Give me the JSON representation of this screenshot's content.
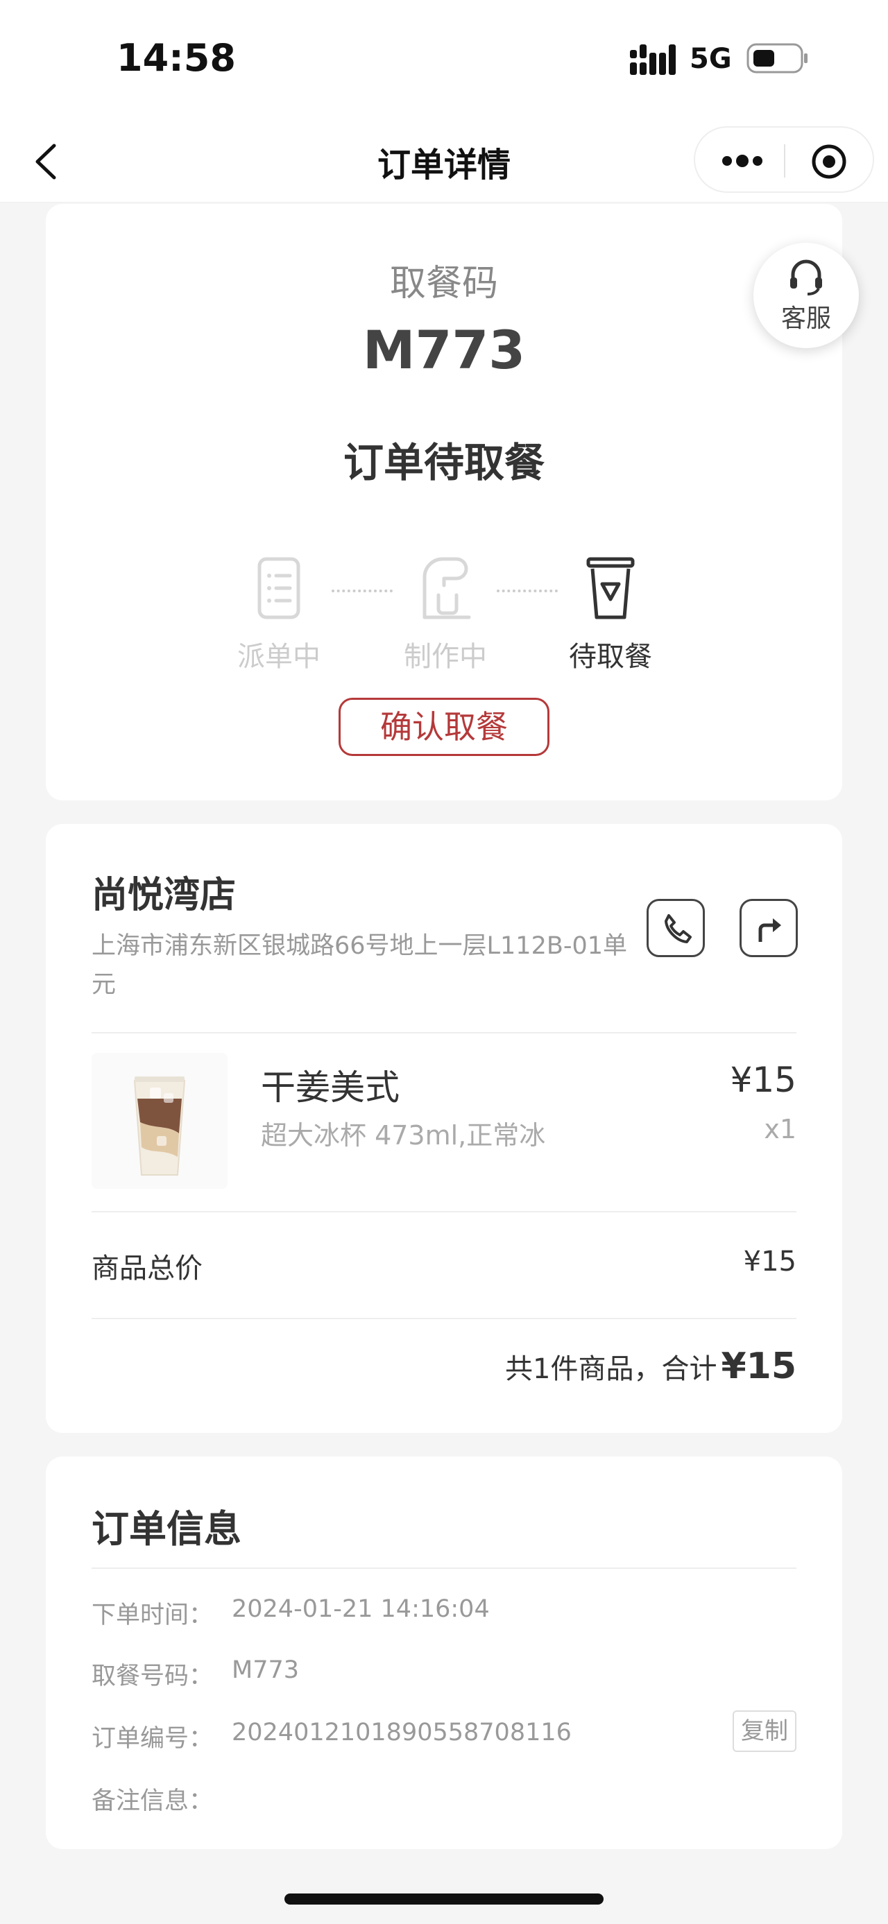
{
  "status_bar": {
    "time": "14:58",
    "network": "5G"
  },
  "nav": {
    "title": "订单详情"
  },
  "pickup": {
    "label": "取餐码",
    "code": "M773",
    "status": "订单待取餐",
    "steps": [
      "派单中",
      "制作中",
      "待取餐"
    ],
    "active_step": 3,
    "confirm_label": "确认取餐"
  },
  "customer_service": {
    "label": "客服"
  },
  "store": {
    "name": "尚悦湾店",
    "address": "上海市浦东新区银城路66号地上一层L112B-01单元"
  },
  "product": {
    "name": "干姜美式",
    "spec": "超大冰杯 473ml,正常冰",
    "price": "¥15",
    "qty": "x1"
  },
  "totals": {
    "subtotal_label": "商品总价",
    "subtotal_value": "¥15",
    "summary_prefix": "共1件商品，合计",
    "total": "¥15"
  },
  "order_info": {
    "title": "订单信息",
    "rows": [
      {
        "key": "下单时间：",
        "value": "2024-01-21 14:16:04"
      },
      {
        "key": "取餐号码：",
        "value": "M773"
      },
      {
        "key": "订单编号：",
        "value": "20240121018905587081​16"
      },
      {
        "key": "备注信息：",
        "value": ""
      }
    ],
    "copy_label": "复制"
  },
  "colors": {
    "accent": "#b5393a",
    "background": "#f5f5f5"
  }
}
